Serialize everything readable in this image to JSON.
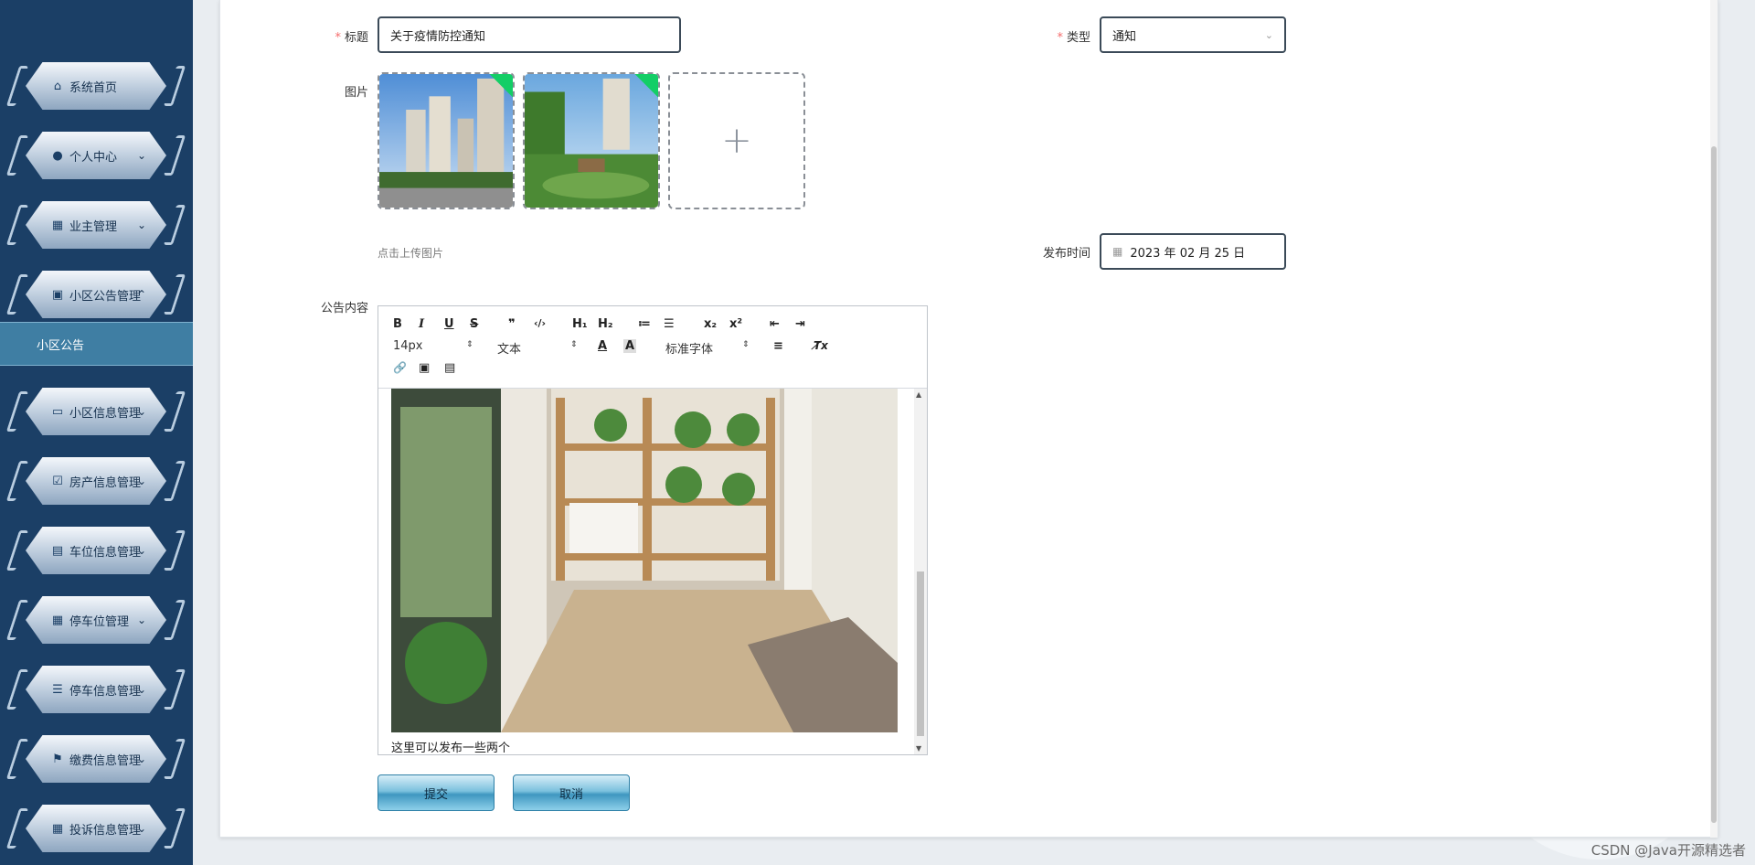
{
  "sidebar": {
    "items": [
      {
        "label": "系统首页",
        "icon": "home-icon",
        "glyph": "⌂"
      },
      {
        "label": "个人中心",
        "icon": "user-icon",
        "glyph": "●"
      },
      {
        "label": "业主管理",
        "icon": "grid-icon",
        "glyph": "▦"
      },
      {
        "label": "小区公告管理",
        "icon": "wallet-icon",
        "glyph": "▣"
      },
      {
        "label": "小区信息管理",
        "icon": "monitor-icon",
        "glyph": "▭"
      },
      {
        "label": "房产信息管理",
        "icon": "clipboard-check-icon",
        "glyph": "☑"
      },
      {
        "label": "车位信息管理",
        "icon": "clipboard-icon",
        "glyph": "▤"
      },
      {
        "label": "停车位管理",
        "icon": "grid-icon",
        "glyph": "▦"
      },
      {
        "label": "停车信息管理",
        "icon": "list-icon",
        "glyph": "☰"
      },
      {
        "label": "缴费信息管理",
        "icon": "flag-icon",
        "glyph": "⚑"
      },
      {
        "label": "投诉信息管理",
        "icon": "grid-icon",
        "glyph": "▦"
      }
    ],
    "submenu_active": "小区公告"
  },
  "form": {
    "title_label": "标题",
    "title_value": "关于疫情防控通知",
    "type_label": "类型",
    "type_value": "通知",
    "image_label": "图片",
    "upload_hint": "点击上传图片",
    "publish_time_label": "发布时间",
    "publish_time_value": "2023 年 02 月 25 日",
    "content_label": "公告内容",
    "required_mark": "*"
  },
  "editor": {
    "toolbar": {
      "bold": "B",
      "italic": "I",
      "underline": "U",
      "strike": "S",
      "quote": "❞",
      "code": "‹/›",
      "h1": "H₁",
      "h2": "H₂",
      "ordered_list": "≔",
      "bullet_list": "☰",
      "subscript": "x₂",
      "superscript": "x²",
      "outdent": "⇤",
      "indent": "⇥",
      "size_value": "14px",
      "paragraph_value": "文本",
      "color": "A",
      "background": "A",
      "font_value": "标准字体",
      "align": "≡",
      "clear": "T̸x",
      "link": "🔗",
      "image": "▣",
      "video": "▤"
    },
    "content_text": "这里可以发布一些两个"
  },
  "buttons": {
    "submit": "提交",
    "cancel": "取消"
  },
  "watermark": "CSDN @Java开源精选者",
  "colors": {
    "sidebar_bg": "#1b3f66",
    "submenu_active_bg": "#3f7ea3",
    "required": "#f56c6c",
    "upload_success_corner": "#13ce66"
  }
}
